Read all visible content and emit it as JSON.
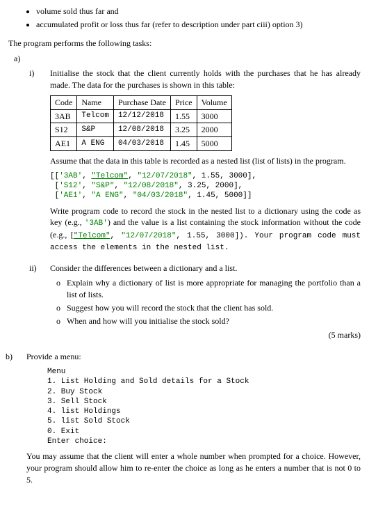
{
  "bullets": {
    "b1": "volume sold thus far and",
    "b2": "accumulated profit or loss thus far (refer to description under part ciii) option 3)"
  },
  "intro": "The program performs the following tasks:",
  "a": {
    "label": "a)",
    "i": {
      "label": "i)",
      "p1": "Initialise the stock that the client currently holds with the purchases that he has already made. The data for the purchases is shown in this table:",
      "table": {
        "h0": "Code",
        "h1": "Name",
        "h2": "Purchase Date",
        "h3": "Price",
        "h4": "Volume",
        "r0c0": "3AB",
        "r0c1": "Telcom",
        "r0c2": "12/12/2018",
        "r0c3": "1.55",
        "r0c4": "3000",
        "r1c0": "S12",
        "r1c1": "S&P",
        "r1c2": "12/08/2018",
        "r1c3": "3.25",
        "r1c4": "2000",
        "r2c0": "AE1",
        "r2c1": "A ENG",
        "r2c2": "04/03/2018",
        "r2c3": "1.45",
        "r2c4": "5000"
      },
      "p2": "Assume that the data in this table is recorded as a nested list (list of lists) in the program.",
      "code1": {
        "l1a": "[[",
        "l1b": "'3AB'",
        "l1c": ", ",
        "l1d": "\"Telcom\"",
        "l1e": ", ",
        "l1f": "\"12/07/2018\"",
        "l1g": ", 1.55, 3000],",
        "l2a": " [",
        "l2b": "'S12'",
        "l2c": ", ",
        "l2d": "\"S&P\"",
        "l2e": ", ",
        "l2f": "\"12/08/2018\"",
        "l2g": ", 3.25, 2000],",
        "l3a": " [",
        "l3b": "'AE1'",
        "l3c": ", ",
        "l3d": "\"A ENG\"",
        "l3e": ", ",
        "l3f": "\"04/03/2018\"",
        "l3g": ", 1.45, 5000]]"
      },
      "p3a": "Write program code to record the stock in the nested list to a dictionary using the code as key (e.g., ",
      "p3b": "'3AB'",
      "p3c": ") and the value is a list containing the stock information without the code (e.g., [",
      "p3d": "\"Telcom\"",
      "p3e": ", ",
      "p3f": "\"12/07/2018\"",
      "p3g": ", 1.55, 3000]). Your program code must access the elements in the nested list."
    },
    "ii": {
      "label": "ii)",
      "p1": "Consider the differences between a dictionary and a list.",
      "s1": "Explain why a dictionary of list is more appropriate for managing the portfolio than a list of lists.",
      "s2": "Suggest how you will record the stock that the client has sold.",
      "s3": "When and how will you initialise the stock sold?",
      "marks": "(5 marks)"
    }
  },
  "b": {
    "label": "b)",
    "p1": "Provide a menu:",
    "menu": {
      "l0": "Menu",
      "l1": "1. List Holding and Sold details for a Stock",
      "l2": "2. Buy Stock",
      "l3": "3. Sell Stock",
      "l4": "4. list Holdings",
      "l5": "5. list Sold Stock",
      "l6": "0. Exit",
      "l7": "Enter choice:"
    },
    "p2": "You may assume that the client will enter a whole number when prompted for a choice. However, your program should allow him to re-enter the choice as long as he enters a number that is not 0 to 5."
  }
}
